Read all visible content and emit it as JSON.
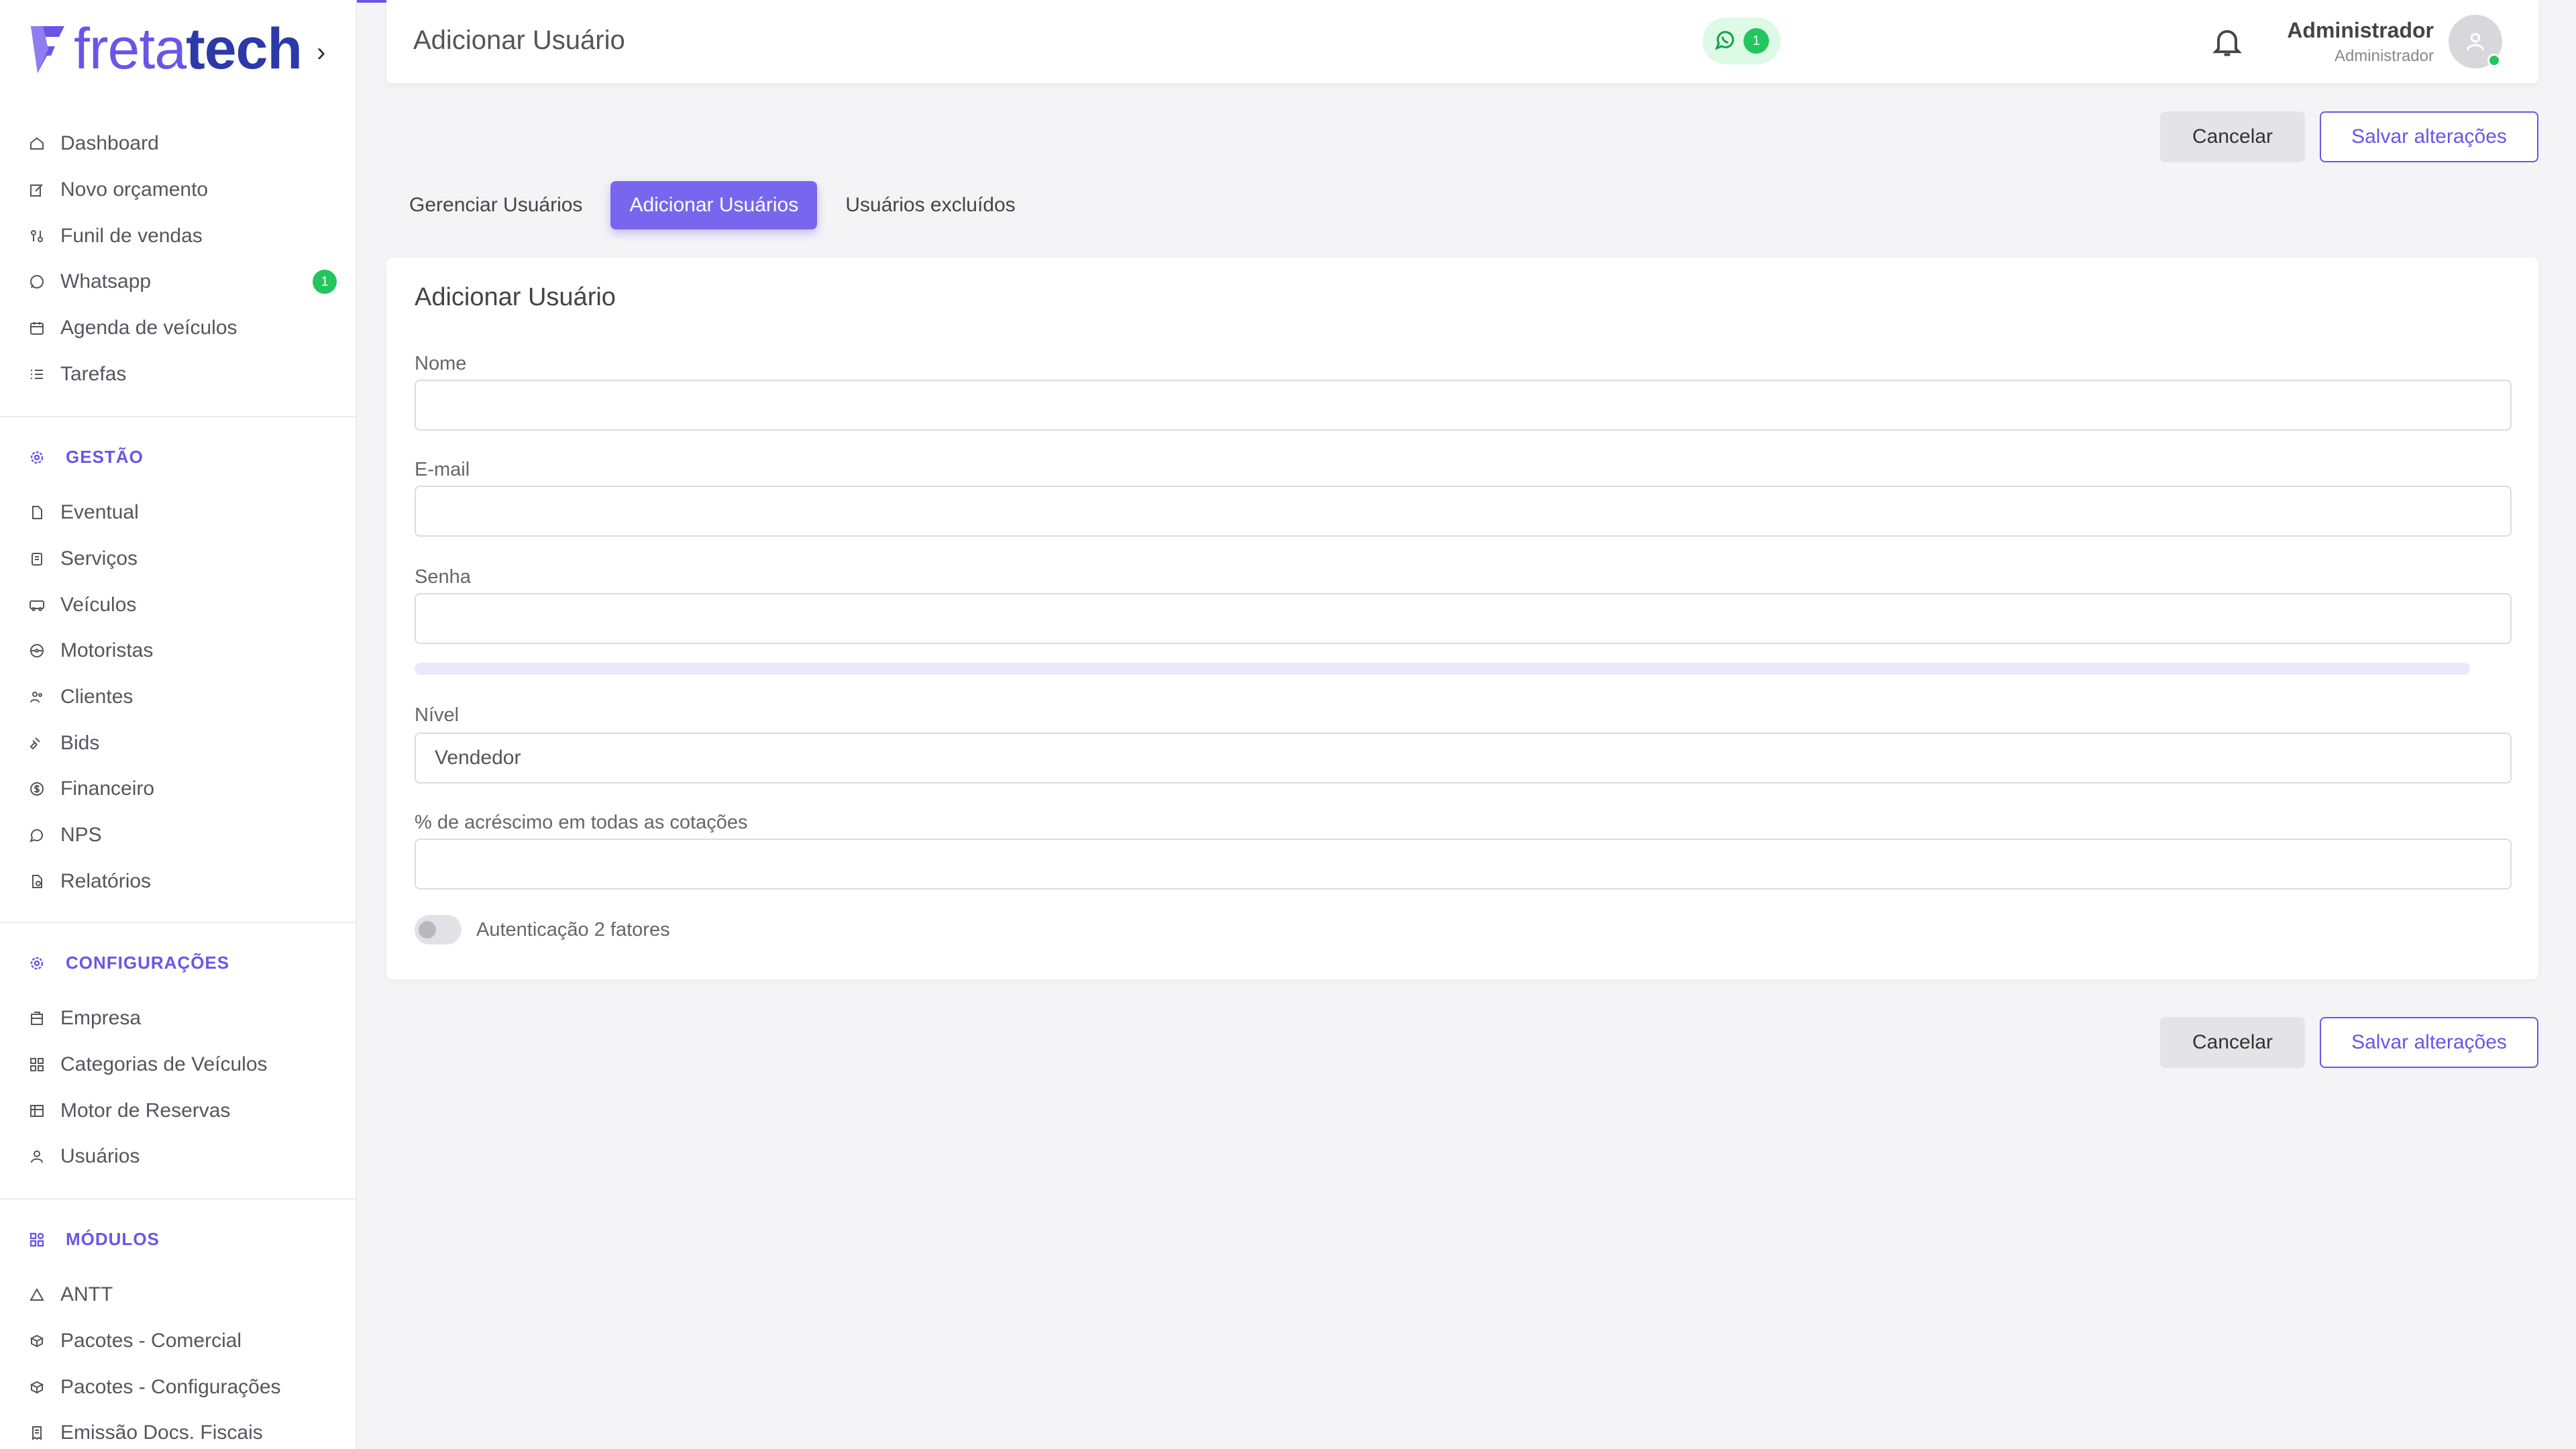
{
  "app": {
    "logo_part1": "freta",
    "logo_part2": "tech",
    "brand_color": "#6a55e6",
    "accent_green": "#22c55e"
  },
  "sidebar": {
    "main_items": [
      {
        "label": "Dashboard",
        "icon": "home-icon"
      },
      {
        "label": "Novo orçamento",
        "icon": "edit-icon"
      },
      {
        "label": "Funil de vendas",
        "icon": "funnel-icon"
      },
      {
        "label": "Whatsapp",
        "icon": "whatsapp-icon",
        "badge": "1"
      },
      {
        "label": "Agenda de veículos",
        "icon": "calendar-icon"
      },
      {
        "label": "Tarefas",
        "icon": "list-icon"
      }
    ],
    "gestao": {
      "title": "GESTÃO",
      "items": [
        {
          "label": "Eventual",
          "icon": "document-icon"
        },
        {
          "label": "Serviços",
          "icon": "clipboard-icon"
        },
        {
          "label": "Veículos",
          "icon": "bus-icon"
        },
        {
          "label": "Motoristas",
          "icon": "steering-wheel-icon"
        },
        {
          "label": "Clientes",
          "icon": "users-icon"
        },
        {
          "label": "Bids",
          "icon": "gavel-icon"
        },
        {
          "label": "Financeiro",
          "icon": "dollar-icon"
        },
        {
          "label": "NPS",
          "icon": "chat-icon"
        },
        {
          "label": "Relatórios",
          "icon": "report-icon"
        }
      ]
    },
    "configuracoes": {
      "title": "CONFIGURAÇÕES",
      "items": [
        {
          "label": "Empresa",
          "icon": "building-icon"
        },
        {
          "label": "Categorias de Veículos",
          "icon": "grid-icon"
        },
        {
          "label": "Motor de Reservas",
          "icon": "table-icon"
        },
        {
          "label": "Usuários",
          "icon": "user-icon"
        }
      ]
    },
    "modulos": {
      "title": "MÓDULOS",
      "items": [
        {
          "label": "ANTT",
          "icon": "triangle-icon"
        },
        {
          "label": "Pacotes - Comercial",
          "icon": "package-icon"
        },
        {
          "label": "Pacotes - Configurações",
          "icon": "package-icon"
        },
        {
          "label": "Emissão Docs. Fiscais",
          "icon": "receipt-icon"
        }
      ]
    }
  },
  "header": {
    "title": "Adicionar Usuário",
    "whatsapp_count": "1",
    "user_name": "Administrador",
    "user_role": "Administrador"
  },
  "actions": {
    "cancel_label": "Cancelar",
    "save_label": "Salvar alterações"
  },
  "tabs": [
    {
      "label": "Gerenciar Usuários",
      "active": false
    },
    {
      "label": "Adicionar Usuários",
      "active": true
    },
    {
      "label": "Usuários excluídos",
      "active": false
    }
  ],
  "form": {
    "title": "Adicionar Usuário",
    "nome_label": "Nome",
    "nome_value": "",
    "email_label": "E-mail",
    "email_value": "",
    "senha_label": "Senha",
    "senha_value": "",
    "nivel_label": "Nível",
    "nivel_value": "Vendedor",
    "acrescimo_label": "% de acréscimo em todas as cotações",
    "acrescimo_value": "",
    "two_factor_label": "Autenticação 2 fatores",
    "two_factor_enabled": false
  }
}
